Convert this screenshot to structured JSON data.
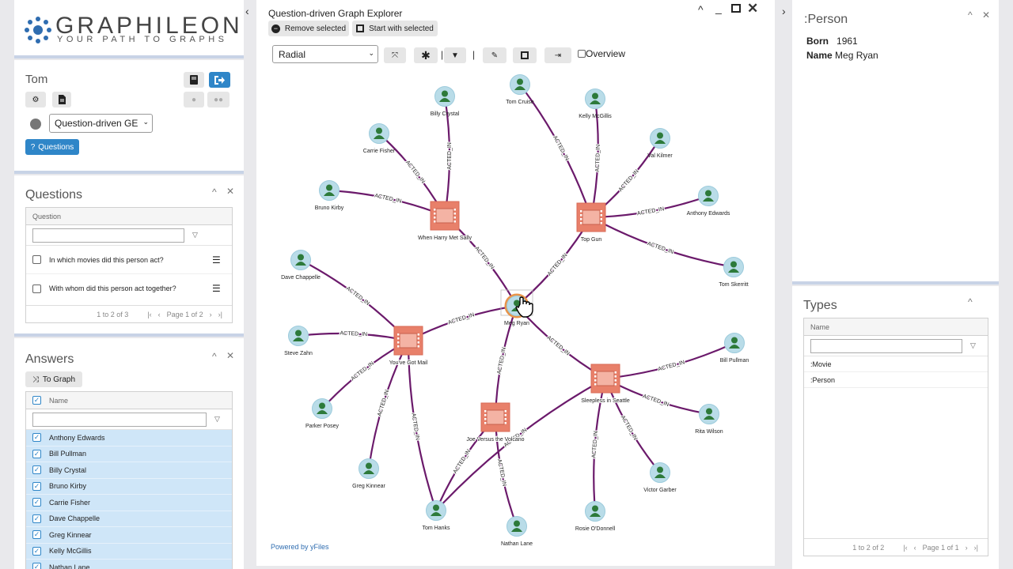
{
  "logo": {
    "name": "GRAPHILEON",
    "tagline": "YOUR PATH TO GRAPHS"
  },
  "user_panel": {
    "user": "Tom",
    "dashboard_select": "Question-driven GE",
    "questions_button": "Questions"
  },
  "questions_panel": {
    "title": "Questions",
    "column": "Question",
    "rows": [
      "In which movies did this person act?",
      "With whom did this person act together?"
    ],
    "footer_count": "1 to 2 of 3",
    "footer_page": "Page 1 of 2"
  },
  "answers_panel": {
    "title": "Answers",
    "to_graph": "To Graph",
    "column": "Name",
    "rows": [
      "Anthony Edwards",
      "Bill Pullman",
      "Billy Crystal",
      "Bruno Kirby",
      "Carrie Fisher",
      "Dave Chappelle",
      "Greg Kinnear",
      "Kelly McGillis",
      "Nathan Lane"
    ]
  },
  "explorer": {
    "title": "Question-driven Graph Explorer",
    "remove_selected": "Remove selected",
    "start_with_selected": "Start with selected",
    "layout_select": "Radial",
    "overview_label": "Overview",
    "powered_by": "Powered by yFiles",
    "edge_label": "ACTED_IN"
  },
  "graph": {
    "center": {
      "name": "Meg Ryan"
    },
    "movies": [
      {
        "name": "When Harry Met Sally"
      },
      {
        "name": "Top Gun"
      },
      {
        "name": "You've Got Mail"
      },
      {
        "name": "Sleepless in Seattle"
      },
      {
        "name": "Joe Versus the Volcano"
      }
    ],
    "persons": [
      {
        "name": "Billy Crystal"
      },
      {
        "name": "Carrie Fisher"
      },
      {
        "name": "Bruno Kirby"
      },
      {
        "name": "Tom Cruise"
      },
      {
        "name": "Kelly McGillis"
      },
      {
        "name": "Val Kilmer"
      },
      {
        "name": "Anthony Edwards"
      },
      {
        "name": "Tom Skerritt"
      },
      {
        "name": "Dave Chappelle"
      },
      {
        "name": "Steve Zahn"
      },
      {
        "name": "Parker Posey"
      },
      {
        "name": "Greg Kinnear"
      },
      {
        "name": "Tom Hanks"
      },
      {
        "name": "Nathan Lane"
      },
      {
        "name": "Bill Pullman"
      },
      {
        "name": "Rita Wilson"
      },
      {
        "name": "Victor Garber"
      },
      {
        "name": "Rosie O'Donnell"
      }
    ],
    "colors": {
      "edge": "#6b1a6b",
      "movie": "#e8806a",
      "person_bg": "#b9dce8",
      "person_fg": "#2d7a3a",
      "center_ring": "#e8944a"
    }
  },
  "person_panel": {
    "title": ":Person",
    "props": [
      {
        "key": "Born",
        "value": "1961"
      },
      {
        "key": "Name",
        "value": "Meg Ryan"
      }
    ]
  },
  "types_panel": {
    "title": "Types",
    "column": "Name",
    "rows": [
      ":Movie",
      ":Person"
    ],
    "footer_count": "1 to 2 of 2",
    "footer_page": "Page 1 of 1"
  }
}
